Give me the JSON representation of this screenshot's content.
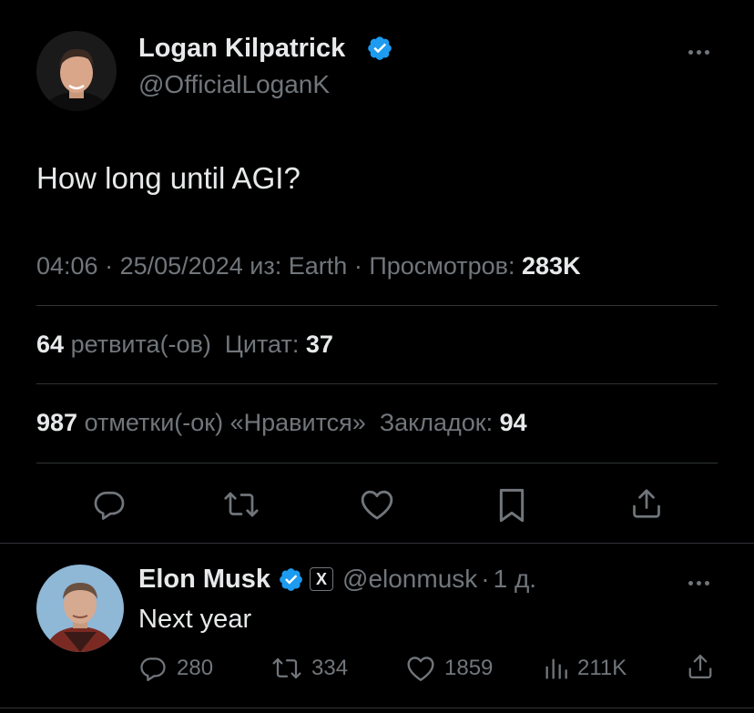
{
  "tweet": {
    "author_name": "Logan Kilpatrick",
    "author_handle": "@OfficialLoganK",
    "text": "How long until AGI?",
    "time": "04:06",
    "sep1": "·",
    "date": "25/05/2024",
    "from_label": "из:",
    "location": "Earth",
    "sep2": "·",
    "views_label": "Просмотров:",
    "views_value": "283K"
  },
  "stats": {
    "retweets_value": "64",
    "retweets_label": "ретвита(-ов)",
    "quotes_label": "Цитат:",
    "quotes_value": "37",
    "likes_value": "987",
    "likes_label": "отметки(-ок) «Нравится»",
    "bookmarks_label": "Закладок:",
    "bookmarks_value": "94"
  },
  "actions": [
    "reply-icon",
    "retweet-icon",
    "like-icon",
    "bookmark-icon",
    "share-icon"
  ],
  "reply": {
    "author_name": "Elon Musk",
    "affiliate_badge": "X",
    "author_handle": "@elonmusk",
    "sep": "·",
    "age": "1 д.",
    "text": "Next year",
    "replies": "280",
    "retweets": "334",
    "likes": "1859",
    "views": "211K"
  },
  "colors": {
    "background": "#000000",
    "text": "#e7e9ea",
    "secondary": "#71767b",
    "verified": "#1d9bf0",
    "divider": "#2f3336"
  }
}
